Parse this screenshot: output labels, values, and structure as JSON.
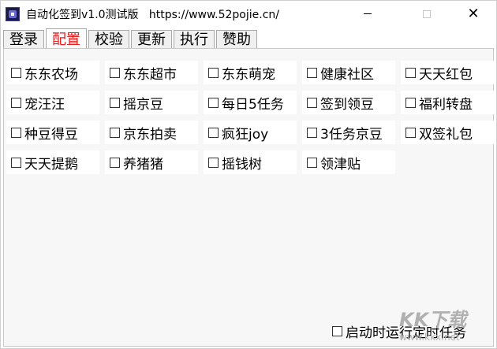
{
  "window": {
    "title": "自动化签到v1.0测试版   https://www.52pojie.cn/",
    "close_glyph": "✕"
  },
  "tabs": [
    "登录",
    "配置",
    "校验",
    "更新",
    "执行",
    "赞助"
  ],
  "checkboxes": [
    [
      "东东农场",
      "东东超市",
      "东东萌宠",
      "健康社区",
      "天天红包"
    ],
    [
      "宠汪汪",
      "摇京豆",
      "每日5任务",
      "签到领豆",
      "福利转盘"
    ],
    [
      "种豆得豆",
      "京东拍卖",
      "疯狂joy",
      "3任务京豆",
      "双签礼包"
    ],
    [
      "天天提鹅",
      "养猪猪",
      "摇钱树",
      "领津贴"
    ]
  ],
  "footer": {
    "startup_task": "启动时运行定时任务"
  },
  "watermark": {
    "logo": "KK下载",
    "url": "www.kkx.net"
  },
  "colors": {
    "active_tab": "#e02020"
  }
}
